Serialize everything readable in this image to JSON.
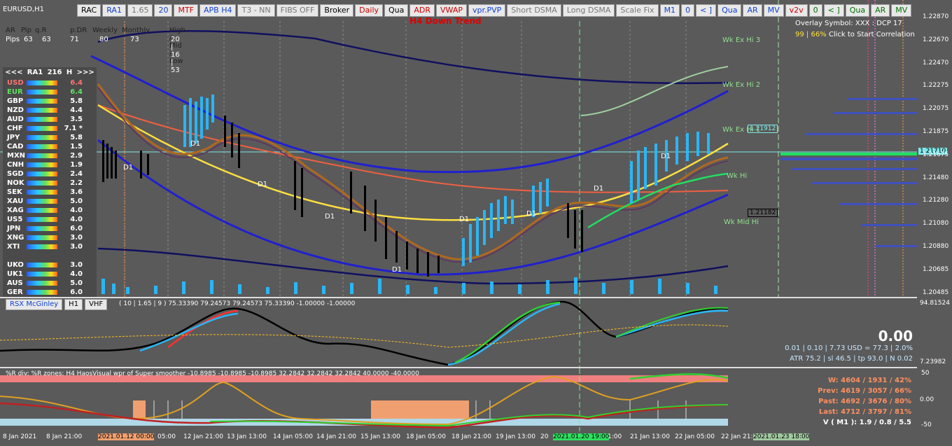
{
  "symbol": "EURUSD,H1",
  "toolbar": [
    {
      "label": "RAC",
      "c": ""
    },
    {
      "label": "RA1",
      "c": "blue"
    },
    {
      "label": "1.65",
      "c": "grey"
    },
    {
      "label": "20",
      "c": "blue"
    },
    {
      "label": "MTF",
      "c": "red"
    },
    {
      "label": "APB H4",
      "c": "blue"
    },
    {
      "label": "T3 - NN",
      "c": "grey"
    },
    {
      "label": "FIBS OFF",
      "c": "grey"
    },
    {
      "label": "Broker",
      "c": ""
    },
    {
      "label": "Daily",
      "c": "red"
    },
    {
      "label": "Qua",
      "c": ""
    },
    {
      "label": "ADR",
      "c": "red"
    },
    {
      "label": "VWAP",
      "c": "red"
    },
    {
      "label": "vpr.PVP",
      "c": "blue"
    },
    {
      "label": "Short DSMA",
      "c": "grey"
    },
    {
      "label": "Long DSMA",
      "c": "grey"
    },
    {
      "label": "Scale Fix",
      "c": "grey"
    },
    {
      "label": "M1",
      "c": "blue"
    },
    {
      "label": "0",
      "c": "blue"
    },
    {
      "label": "< ]",
      "c": "blue"
    },
    {
      "label": "Qua",
      "c": "blue"
    },
    {
      "label": "AR",
      "c": "blue"
    },
    {
      "label": "MV",
      "c": "blue"
    },
    {
      "label": "v2v",
      "c": "red"
    },
    {
      "label": "0",
      "c": "green"
    },
    {
      "label": "< ]",
      "c": "green"
    },
    {
      "label": "Qua",
      "c": "green"
    },
    {
      "label": "AR",
      "c": "green"
    },
    {
      "label": "MV",
      "c": "green"
    }
  ],
  "trend_label": "H4 Down Trend",
  "stats_header": [
    "AR",
    "Pip",
    "q.R",
    "p.DR",
    "Weekly",
    "Monthly",
    "High / Mid / Low"
  ],
  "stats_values": [
    "Pips",
    "63",
    "63",
    "71",
    "80",
    "73",
    "20 | 16 | 53"
  ],
  "panel_title": {
    "prev": "<<<",
    "name": "RA1",
    "period": "216",
    "tf": "H",
    "next": ">>>"
  },
  "currencies": [
    {
      "name": "USD",
      "value": "6.4",
      "color": "#ff7070"
    },
    {
      "name": "EUR",
      "value": "6.4",
      "color": "#60e060"
    },
    {
      "name": "GBP",
      "value": "5.8",
      "color": "#ffffff"
    },
    {
      "name": "NZD",
      "value": "4.4",
      "color": "#ffffff"
    },
    {
      "name": "AUD",
      "value": "3.5",
      "color": "#ffffff"
    },
    {
      "name": "CHF",
      "value": "7.1 *",
      "color": "#ffffff"
    },
    {
      "name": "JPY",
      "value": "5.8",
      "color": "#ffffff"
    },
    {
      "name": "CAD",
      "value": "1.5",
      "color": "#ffffff"
    },
    {
      "name": "MXN",
      "value": "2.9",
      "color": "#ffffff"
    },
    {
      "name": "CNH",
      "value": "1.9",
      "color": "#ffffff"
    },
    {
      "name": "SGD",
      "value": "2.4",
      "color": "#ffffff"
    },
    {
      "name": "NOK",
      "value": "2.2",
      "color": "#ffffff"
    },
    {
      "name": "SEK",
      "value": "3.6",
      "color": "#ffffff"
    },
    {
      "name": "XAU",
      "value": "5.0",
      "color": "#ffffff"
    },
    {
      "name": "XAG",
      "value": "4.0",
      "color": "#ffffff"
    },
    {
      "name": "US5",
      "value": "4.0",
      "color": "#ffffff"
    },
    {
      "name": "JPN",
      "value": "6.0",
      "color": "#ffffff"
    },
    {
      "name": "XNG",
      "value": "3.0",
      "color": "#ffffff"
    },
    {
      "name": "XTI",
      "value": "3.0",
      "color": "#ffffff"
    },
    {
      "name": "UKO",
      "value": "3.0",
      "color": "#ffffff"
    },
    {
      "name": "UK1",
      "value": "4.0",
      "color": "#ffffff"
    },
    {
      "name": "AUS",
      "value": "5.0",
      "color": "#ffffff"
    },
    {
      "name": "GER",
      "value": "6.0",
      "color": "#ffffff"
    }
  ],
  "overlay": {
    "line1": "Overlay Symbol: XXX : DCP 17",
    "line2a": "99 | 66%",
    "line2b": " Click to Start Correlation"
  },
  "price_axis": [
    "1.22870",
    "1.22670",
    "1.22470",
    "1.22275",
    "1.22075",
    "1.21875",
    "1.21675",
    "1.21480",
    "1.21280",
    "1.21080",
    "1.20880",
    "1.20685",
    "1.20485"
  ],
  "price_tags": {
    "current": "1.21710",
    "upper": "1.21912",
    "lower": "1.21182"
  },
  "week_labels": [
    "Wk Ex Hi 3",
    "Wk Ex Hi 2",
    "Wk Ex Hi 1",
    "Wk Hi",
    "Wk Mid Hi"
  ],
  "d1_label": "D1",
  "sub1": {
    "buttons": [
      "RSX McGinley",
      "H1",
      "VHF"
    ],
    "info": "( 10 | 1.65 | 9 ) 75.33390 79.24573 79.24573 75.33390 -1.00000 -1.00000",
    "axis_top": "94.81524",
    "axis_bottom": "7.23982",
    "big": "0.00",
    "line1": "0.01  |  0.10  |  7.73 USD = 77.3  |  2.0%",
    "line2": "ATR 75.2  |  sl 46.5  |  tp 93.0  |  N 0.02"
  },
  "sub2": {
    "info": "%R div: %R zones: H4 HaosVisual wpr of Super smoother -10.8985 -10.8985 -10.8985 32.2842 32.2842 32.2842 40.0000 -40.0000",
    "axis": [
      "50",
      "0.00",
      "-50"
    ],
    "stats": [
      "W: 4604 / 1931 / 42%",
      "Prev: 4619 / 3057 / 66%",
      "Past: 4692 / 3676 / 80%",
      "Last: 4712 / 3797 / 81%",
      "V ( M1 ): 1.9 / 0.8 / 5.5"
    ]
  },
  "time_axis": [
    "8 Jan 2021",
    "8 Jan 21:00",
    "2021.01.12 00:00",
    "05:00",
    "12 Jan 21:00",
    "13 Jan 13:00",
    "14 Jan 05:00",
    "14 Jan 21:00",
    "15 Jan 13:00",
    "18 Jan 05:00",
    "18 Jan 21:00",
    "19 Jan 13:00",
    "20",
    "2021.01.20 19:00",
    "1:00",
    "21 Jan 13:00",
    "22 Jan 05:00",
    "22 Jan 21:0",
    "2021.01.23 18:00"
  ]
}
